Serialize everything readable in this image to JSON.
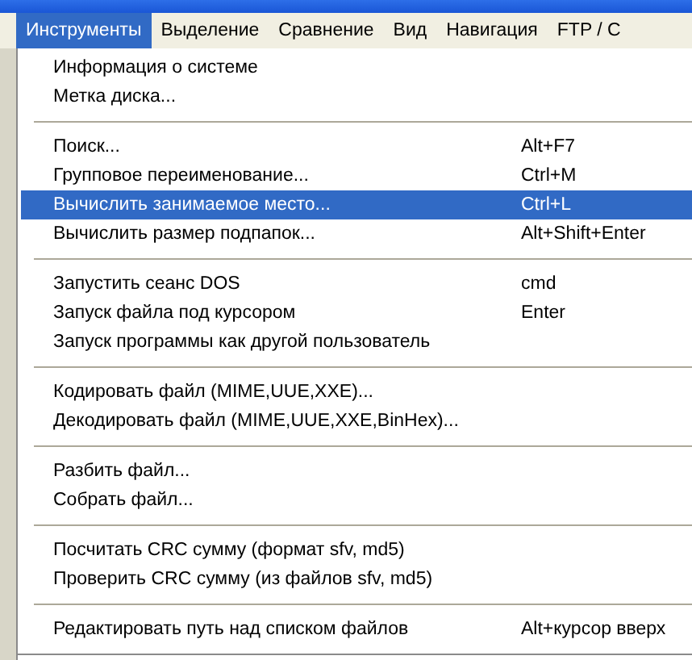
{
  "menubar": [
    {
      "label": "Инструменты",
      "selected": true
    },
    {
      "label": "Выделение",
      "selected": false
    },
    {
      "label": "Сравнение",
      "selected": false
    },
    {
      "label": "Вид",
      "selected": false
    },
    {
      "label": "Навигация",
      "selected": false
    },
    {
      "label": "FTP / C",
      "selected": false
    }
  ],
  "menu": {
    "groups": [
      [
        {
          "label": "Информация о системе",
          "selected": false
        },
        {
          "label": "Метка диска...",
          "selected": false
        }
      ],
      [
        {
          "label": "Поиск...",
          "shortcut": "Alt+F7",
          "selected": false
        },
        {
          "label": "Групповое переименование...",
          "shortcut": "Ctrl+M",
          "selected": false
        },
        {
          "label": "Вычислить занимаемое место...",
          "shortcut": "Ctrl+L",
          "selected": true
        },
        {
          "label": "Вычислить размер подпапок...",
          "shortcut": "Alt+Shift+Enter",
          "selected": false
        }
      ],
      [
        {
          "label": "Запустить сеанс DOS",
          "shortcut": "cmd",
          "selected": false
        },
        {
          "label": "Запуск файла под курсором",
          "shortcut": "Enter",
          "selected": false
        },
        {
          "label": "Запуск программы как другой пользователь",
          "selected": false
        }
      ],
      [
        {
          "label": "Кодировать файл (MIME,UUE,XXE)...",
          "selected": false
        },
        {
          "label": "Декодировать файл (MIME,UUE,XXE,BinHex)...",
          "selected": false
        }
      ],
      [
        {
          "label": "Разбить файл...",
          "selected": false
        },
        {
          "label": "Собрать файл...",
          "selected": false
        }
      ],
      [
        {
          "label": "Посчитать CRC сумму (формат sfv, md5)",
          "selected": false
        },
        {
          "label": "Проверить CRC сумму (из файлов sfv, md5)",
          "selected": false
        }
      ],
      [
        {
          "label": "Редактировать путь над списком файлов",
          "shortcut": "Alt+курсор вверх",
          "selected": false
        }
      ]
    ]
  }
}
